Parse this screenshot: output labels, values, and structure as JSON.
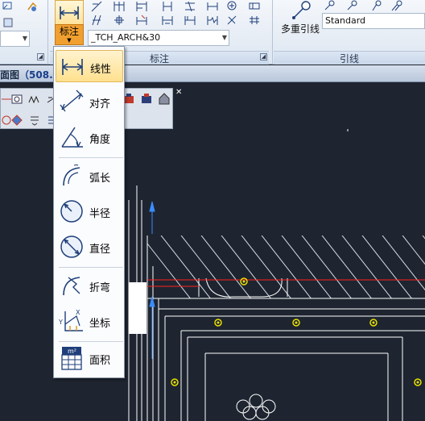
{
  "ribbon": {
    "dimension_button_label": "标注",
    "dimension_style_value": "_TCH_ARCH&30",
    "leader_style_value": "Standard",
    "multileader_label": "多重引线",
    "panel_dimension_title": "标注",
    "panel_leader_title": "引线"
  },
  "drawing": {
    "title_prefix": "面图",
    "title_coord": "（508.1"
  },
  "menu": {
    "items": [
      {
        "label": "线性",
        "icon": "linear-dimension-icon"
      },
      {
        "label": "对齐",
        "icon": "aligned-dimension-icon"
      },
      {
        "label": "角度",
        "icon": "angular-dimension-icon"
      },
      {
        "label": "弧长",
        "icon": "arc-length-icon"
      },
      {
        "label": "半径",
        "icon": "radius-icon"
      },
      {
        "label": "直径",
        "icon": "diameter-icon"
      },
      {
        "label": "折弯",
        "icon": "jogged-icon"
      },
      {
        "label": "坐标",
        "icon": "ordinate-icon"
      },
      {
        "label": "面积",
        "icon": "area-icon"
      }
    ],
    "selected": "线性"
  },
  "colors": {
    "canvas_bg": "#1e2530",
    "menu_highlight": "#ffe08e",
    "active_button": "#f0a030",
    "cad_line": "#ffffff",
    "cad_red": "#ff2020",
    "cad_yellow": "#e8e000",
    "cad_blue": "#3a8cff"
  }
}
